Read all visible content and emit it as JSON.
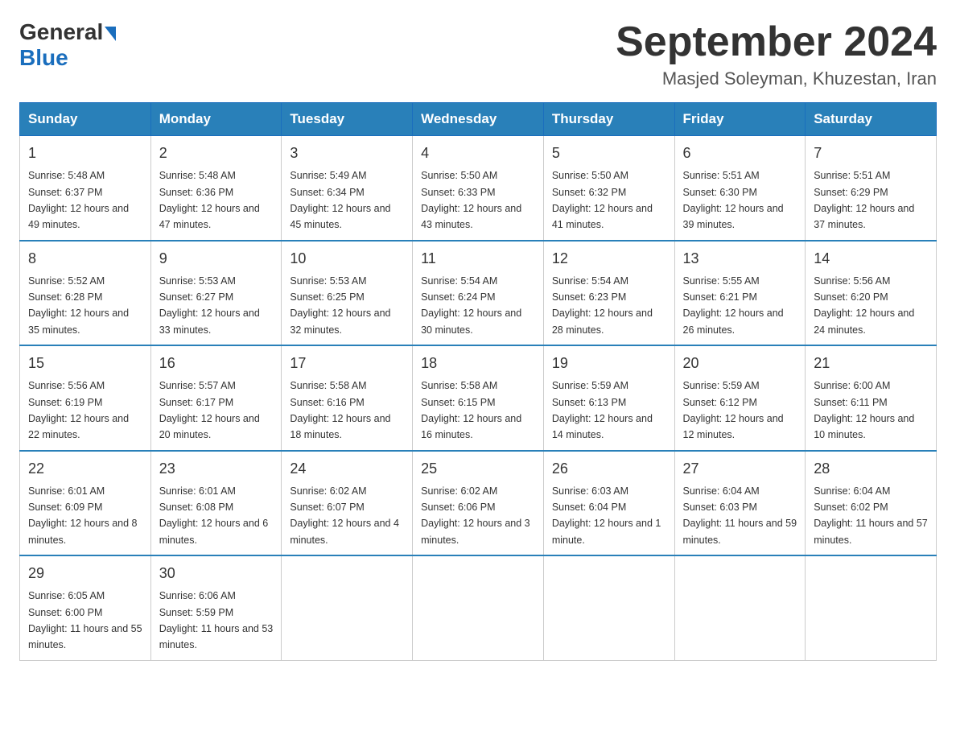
{
  "logo": {
    "general": "General",
    "blue": "Blue"
  },
  "title": "September 2024",
  "location": "Masjed Soleyman, Khuzestan, Iran",
  "days_of_week": [
    "Sunday",
    "Monday",
    "Tuesday",
    "Wednesday",
    "Thursday",
    "Friday",
    "Saturday"
  ],
  "weeks": [
    [
      {
        "day": "1",
        "sunrise": "5:48 AM",
        "sunset": "6:37 PM",
        "daylight": "12 hours and 49 minutes."
      },
      {
        "day": "2",
        "sunrise": "5:48 AM",
        "sunset": "6:36 PM",
        "daylight": "12 hours and 47 minutes."
      },
      {
        "day": "3",
        "sunrise": "5:49 AM",
        "sunset": "6:34 PM",
        "daylight": "12 hours and 45 minutes."
      },
      {
        "day": "4",
        "sunrise": "5:50 AM",
        "sunset": "6:33 PM",
        "daylight": "12 hours and 43 minutes."
      },
      {
        "day": "5",
        "sunrise": "5:50 AM",
        "sunset": "6:32 PM",
        "daylight": "12 hours and 41 minutes."
      },
      {
        "day": "6",
        "sunrise": "5:51 AM",
        "sunset": "6:30 PM",
        "daylight": "12 hours and 39 minutes."
      },
      {
        "day": "7",
        "sunrise": "5:51 AM",
        "sunset": "6:29 PM",
        "daylight": "12 hours and 37 minutes."
      }
    ],
    [
      {
        "day": "8",
        "sunrise": "5:52 AM",
        "sunset": "6:28 PM",
        "daylight": "12 hours and 35 minutes."
      },
      {
        "day": "9",
        "sunrise": "5:53 AM",
        "sunset": "6:27 PM",
        "daylight": "12 hours and 33 minutes."
      },
      {
        "day": "10",
        "sunrise": "5:53 AM",
        "sunset": "6:25 PM",
        "daylight": "12 hours and 32 minutes."
      },
      {
        "day": "11",
        "sunrise": "5:54 AM",
        "sunset": "6:24 PM",
        "daylight": "12 hours and 30 minutes."
      },
      {
        "day": "12",
        "sunrise": "5:54 AM",
        "sunset": "6:23 PM",
        "daylight": "12 hours and 28 minutes."
      },
      {
        "day": "13",
        "sunrise": "5:55 AM",
        "sunset": "6:21 PM",
        "daylight": "12 hours and 26 minutes."
      },
      {
        "day": "14",
        "sunrise": "5:56 AM",
        "sunset": "6:20 PM",
        "daylight": "12 hours and 24 minutes."
      }
    ],
    [
      {
        "day": "15",
        "sunrise": "5:56 AM",
        "sunset": "6:19 PM",
        "daylight": "12 hours and 22 minutes."
      },
      {
        "day": "16",
        "sunrise": "5:57 AM",
        "sunset": "6:17 PM",
        "daylight": "12 hours and 20 minutes."
      },
      {
        "day": "17",
        "sunrise": "5:58 AM",
        "sunset": "6:16 PM",
        "daylight": "12 hours and 18 minutes."
      },
      {
        "day": "18",
        "sunrise": "5:58 AM",
        "sunset": "6:15 PM",
        "daylight": "12 hours and 16 minutes."
      },
      {
        "day": "19",
        "sunrise": "5:59 AM",
        "sunset": "6:13 PM",
        "daylight": "12 hours and 14 minutes."
      },
      {
        "day": "20",
        "sunrise": "5:59 AM",
        "sunset": "6:12 PM",
        "daylight": "12 hours and 12 minutes."
      },
      {
        "day": "21",
        "sunrise": "6:00 AM",
        "sunset": "6:11 PM",
        "daylight": "12 hours and 10 minutes."
      }
    ],
    [
      {
        "day": "22",
        "sunrise": "6:01 AM",
        "sunset": "6:09 PM",
        "daylight": "12 hours and 8 minutes."
      },
      {
        "day": "23",
        "sunrise": "6:01 AM",
        "sunset": "6:08 PM",
        "daylight": "12 hours and 6 minutes."
      },
      {
        "day": "24",
        "sunrise": "6:02 AM",
        "sunset": "6:07 PM",
        "daylight": "12 hours and 4 minutes."
      },
      {
        "day": "25",
        "sunrise": "6:02 AM",
        "sunset": "6:06 PM",
        "daylight": "12 hours and 3 minutes."
      },
      {
        "day": "26",
        "sunrise": "6:03 AM",
        "sunset": "6:04 PM",
        "daylight": "12 hours and 1 minute."
      },
      {
        "day": "27",
        "sunrise": "6:04 AM",
        "sunset": "6:03 PM",
        "daylight": "11 hours and 59 minutes."
      },
      {
        "day": "28",
        "sunrise": "6:04 AM",
        "sunset": "6:02 PM",
        "daylight": "11 hours and 57 minutes."
      }
    ],
    [
      {
        "day": "29",
        "sunrise": "6:05 AM",
        "sunset": "6:00 PM",
        "daylight": "11 hours and 55 minutes."
      },
      {
        "day": "30",
        "sunrise": "6:06 AM",
        "sunset": "5:59 PM",
        "daylight": "11 hours and 53 minutes."
      },
      null,
      null,
      null,
      null,
      null
    ]
  ]
}
